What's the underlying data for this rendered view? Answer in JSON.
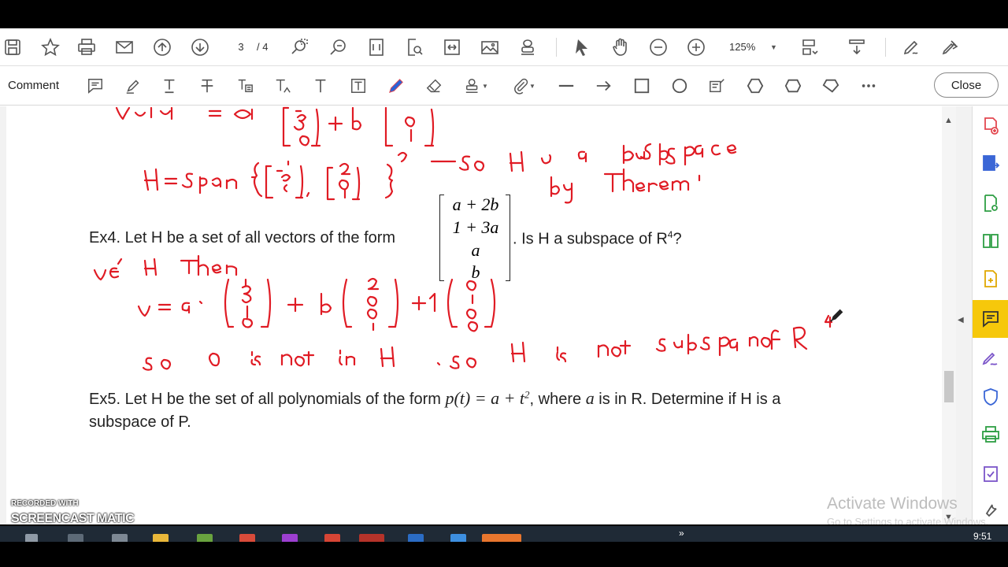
{
  "toolbar": {
    "page_current": "3",
    "page_total": "/ 4",
    "zoom": "125%"
  },
  "comment_toolbar": {
    "label": "Comment",
    "close": "Close"
  },
  "document": {
    "ex4_prefix": "Ex4. Let H be a set of all vectors of the form",
    "ex4_suffix": ". Is H a subspace of R",
    "ex4_sup": "4",
    "ex4_q": "?",
    "matrix": [
      "a + 2b",
      "1 + 3a",
      "a",
      "b"
    ],
    "ex5_line1_prefix": "Ex5. Let H be the set of all polynomials of the form ",
    "ex5_formula": "p(t) = a + t",
    "ex5_formula_sup": "2",
    "ex5_line1_mid": ", where ",
    "ex5_var": "a",
    "ex5_line1_suffix": " is in R. Determine if H is a",
    "ex5_line2": "subspace of P."
  },
  "annotations_handwritten": [
    "H = span{ [-1,-3,-3], [2,0,1] } — so H is a subspace by theorem!",
    "v∈H then",
    "v = a[1,3,0,1] + b[2,0,0,1] + 1[0,1,0,0]",
    "so 0 is not in H , so H is not subspace of R4"
  ],
  "watermarks": {
    "activate_title": "Activate Windows",
    "activate_sub": "Go to Settings to activate Windows.",
    "recorded": "RECORDED WITH",
    "screencast": "SCREENCAST MATIC"
  },
  "taskbar": {
    "clock": "9:51 PM"
  },
  "colors": {
    "ink_red": "#e01b24",
    "accent_yellow": "#f6c80b",
    "acrobat_red": "#e34850",
    "acrobat_blue": "#3a66d6",
    "acrobat_green": "#2e9e44"
  }
}
